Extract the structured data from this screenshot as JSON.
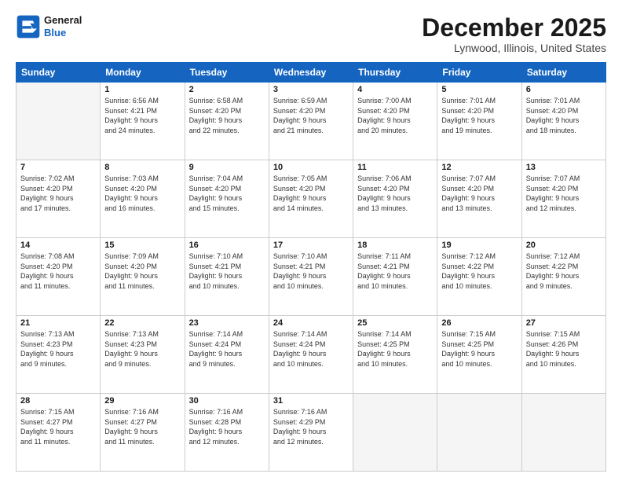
{
  "header": {
    "logo_line1": "General",
    "logo_line2": "Blue",
    "month": "December 2025",
    "location": "Lynwood, Illinois, United States"
  },
  "weekdays": [
    "Sunday",
    "Monday",
    "Tuesday",
    "Wednesday",
    "Thursday",
    "Friday",
    "Saturday"
  ],
  "weeks": [
    [
      {
        "day": "",
        "info": ""
      },
      {
        "day": "1",
        "info": "Sunrise: 6:56 AM\nSunset: 4:21 PM\nDaylight: 9 hours\nand 24 minutes."
      },
      {
        "day": "2",
        "info": "Sunrise: 6:58 AM\nSunset: 4:20 PM\nDaylight: 9 hours\nand 22 minutes."
      },
      {
        "day": "3",
        "info": "Sunrise: 6:59 AM\nSunset: 4:20 PM\nDaylight: 9 hours\nand 21 minutes."
      },
      {
        "day": "4",
        "info": "Sunrise: 7:00 AM\nSunset: 4:20 PM\nDaylight: 9 hours\nand 20 minutes."
      },
      {
        "day": "5",
        "info": "Sunrise: 7:01 AM\nSunset: 4:20 PM\nDaylight: 9 hours\nand 19 minutes."
      },
      {
        "day": "6",
        "info": "Sunrise: 7:01 AM\nSunset: 4:20 PM\nDaylight: 9 hours\nand 18 minutes."
      }
    ],
    [
      {
        "day": "7",
        "info": "Sunrise: 7:02 AM\nSunset: 4:20 PM\nDaylight: 9 hours\nand 17 minutes."
      },
      {
        "day": "8",
        "info": "Sunrise: 7:03 AM\nSunset: 4:20 PM\nDaylight: 9 hours\nand 16 minutes."
      },
      {
        "day": "9",
        "info": "Sunrise: 7:04 AM\nSunset: 4:20 PM\nDaylight: 9 hours\nand 15 minutes."
      },
      {
        "day": "10",
        "info": "Sunrise: 7:05 AM\nSunset: 4:20 PM\nDaylight: 9 hours\nand 14 minutes."
      },
      {
        "day": "11",
        "info": "Sunrise: 7:06 AM\nSunset: 4:20 PM\nDaylight: 9 hours\nand 13 minutes."
      },
      {
        "day": "12",
        "info": "Sunrise: 7:07 AM\nSunset: 4:20 PM\nDaylight: 9 hours\nand 13 minutes."
      },
      {
        "day": "13",
        "info": "Sunrise: 7:07 AM\nSunset: 4:20 PM\nDaylight: 9 hours\nand 12 minutes."
      }
    ],
    [
      {
        "day": "14",
        "info": "Sunrise: 7:08 AM\nSunset: 4:20 PM\nDaylight: 9 hours\nand 11 minutes."
      },
      {
        "day": "15",
        "info": "Sunrise: 7:09 AM\nSunset: 4:20 PM\nDaylight: 9 hours\nand 11 minutes."
      },
      {
        "day": "16",
        "info": "Sunrise: 7:10 AM\nSunset: 4:21 PM\nDaylight: 9 hours\nand 10 minutes."
      },
      {
        "day": "17",
        "info": "Sunrise: 7:10 AM\nSunset: 4:21 PM\nDaylight: 9 hours\nand 10 minutes."
      },
      {
        "day": "18",
        "info": "Sunrise: 7:11 AM\nSunset: 4:21 PM\nDaylight: 9 hours\nand 10 minutes."
      },
      {
        "day": "19",
        "info": "Sunrise: 7:12 AM\nSunset: 4:22 PM\nDaylight: 9 hours\nand 10 minutes."
      },
      {
        "day": "20",
        "info": "Sunrise: 7:12 AM\nSunset: 4:22 PM\nDaylight: 9 hours\nand 9 minutes."
      }
    ],
    [
      {
        "day": "21",
        "info": "Sunrise: 7:13 AM\nSunset: 4:23 PM\nDaylight: 9 hours\nand 9 minutes."
      },
      {
        "day": "22",
        "info": "Sunrise: 7:13 AM\nSunset: 4:23 PM\nDaylight: 9 hours\nand 9 minutes."
      },
      {
        "day": "23",
        "info": "Sunrise: 7:14 AM\nSunset: 4:24 PM\nDaylight: 9 hours\nand 9 minutes."
      },
      {
        "day": "24",
        "info": "Sunrise: 7:14 AM\nSunset: 4:24 PM\nDaylight: 9 hours\nand 10 minutes."
      },
      {
        "day": "25",
        "info": "Sunrise: 7:14 AM\nSunset: 4:25 PM\nDaylight: 9 hours\nand 10 minutes."
      },
      {
        "day": "26",
        "info": "Sunrise: 7:15 AM\nSunset: 4:25 PM\nDaylight: 9 hours\nand 10 minutes."
      },
      {
        "day": "27",
        "info": "Sunrise: 7:15 AM\nSunset: 4:26 PM\nDaylight: 9 hours\nand 10 minutes."
      }
    ],
    [
      {
        "day": "28",
        "info": "Sunrise: 7:15 AM\nSunset: 4:27 PM\nDaylight: 9 hours\nand 11 minutes."
      },
      {
        "day": "29",
        "info": "Sunrise: 7:16 AM\nSunset: 4:27 PM\nDaylight: 9 hours\nand 11 minutes."
      },
      {
        "day": "30",
        "info": "Sunrise: 7:16 AM\nSunset: 4:28 PM\nDaylight: 9 hours\nand 12 minutes."
      },
      {
        "day": "31",
        "info": "Sunrise: 7:16 AM\nSunset: 4:29 PM\nDaylight: 9 hours\nand 12 minutes."
      },
      {
        "day": "",
        "info": ""
      },
      {
        "day": "",
        "info": ""
      },
      {
        "day": "",
        "info": ""
      }
    ]
  ]
}
